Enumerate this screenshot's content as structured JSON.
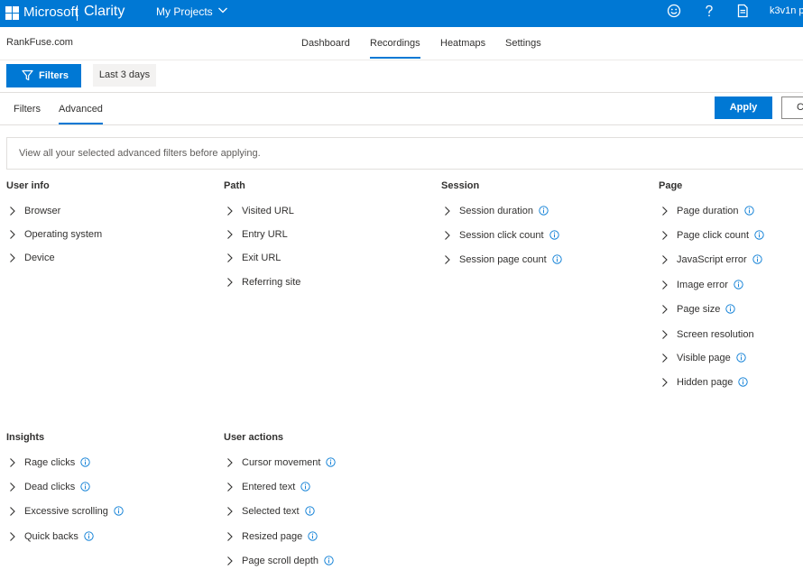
{
  "topbar": {
    "brand": "Microsoft",
    "product": "Clarity",
    "projects_label": "My Projects",
    "user": "k3v1n p",
    "icons": [
      "smiley-icon",
      "help-icon",
      "document-icon"
    ],
    "colors": {
      "bar": "#0078d4"
    }
  },
  "nav": {
    "site": "RankFuse.com",
    "tabs": [
      {
        "label": "Dashboard"
      },
      {
        "label": "Recordings"
      },
      {
        "label": "Heatmaps"
      },
      {
        "label": "Settings"
      }
    ],
    "active_tab": "Recordings"
  },
  "filterbar": {
    "filters_button": "Filters",
    "date_range": "Last 3 days"
  },
  "subtabs": {
    "tabs": [
      {
        "label": "Filters"
      },
      {
        "label": "Advanced"
      }
    ],
    "active": "Advanced",
    "apply": "Apply",
    "cancel": "C"
  },
  "info_message": "View all your selected advanced filters before applying.",
  "groups": {
    "user_info": {
      "title": "User info",
      "items": [
        {
          "label": "Browser",
          "info": false
        },
        {
          "label": "Operating system",
          "info": false
        },
        {
          "label": "Device",
          "info": false
        }
      ]
    },
    "path": {
      "title": "Path",
      "items": [
        {
          "label": "Visited URL",
          "info": false
        },
        {
          "label": "Entry URL",
          "info": false
        },
        {
          "label": "Exit URL",
          "info": false
        },
        {
          "label": "Referring site",
          "info": false
        }
      ]
    },
    "session": {
      "title": "Session",
      "items": [
        {
          "label": "Session duration",
          "info": true
        },
        {
          "label": "Session click count",
          "info": true
        },
        {
          "label": "Session page count",
          "info": true
        }
      ]
    },
    "page": {
      "title": "Page",
      "items": [
        {
          "label": "Page duration",
          "info": true
        },
        {
          "label": "Page click count",
          "info": true
        },
        {
          "label": "JavaScript error",
          "info": true
        },
        {
          "label": "Image error",
          "info": true
        },
        {
          "label": "Page size",
          "info": true
        },
        {
          "label": "Screen resolution",
          "info": false
        },
        {
          "label": "Visible page",
          "info": true
        },
        {
          "label": "Hidden page",
          "info": true
        }
      ]
    },
    "insights": {
      "title": "Insights",
      "items": [
        {
          "label": "Rage clicks",
          "info": true
        },
        {
          "label": "Dead clicks",
          "info": true
        },
        {
          "label": "Excessive scrolling",
          "info": true
        },
        {
          "label": "Quick backs",
          "info": true
        }
      ]
    },
    "user_actions": {
      "title": "User actions",
      "items": [
        {
          "label": "Cursor movement",
          "info": true
        },
        {
          "label": "Entered text",
          "info": true
        },
        {
          "label": "Selected text",
          "info": true
        },
        {
          "label": "Resized page",
          "info": true
        },
        {
          "label": "Page scroll depth",
          "info": true
        }
      ]
    }
  }
}
